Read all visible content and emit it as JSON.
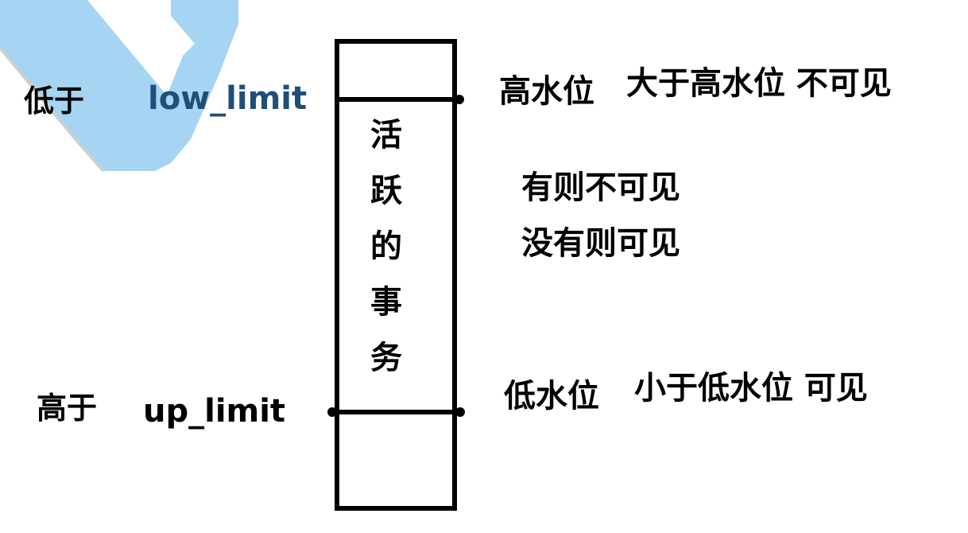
{
  "left": {
    "low_prefix": "低于",
    "low_var": "low_limit",
    "high_prefix": "高于",
    "high_var": "up_limit"
  },
  "column": {
    "chars": [
      "活",
      "跃",
      "的",
      "事",
      "务"
    ]
  },
  "right": {
    "high_mark": "高水位",
    "high_note": "大于高水位 不可见",
    "mid_line1": "有则不可见",
    "mid_line2": "没有则可见",
    "low_mark": "低水位",
    "low_note": "小于低水位 可见"
  },
  "colors": {
    "watermark": "#a5d5f2",
    "line": "#000000",
    "variable_text": "#1f4e79"
  }
}
